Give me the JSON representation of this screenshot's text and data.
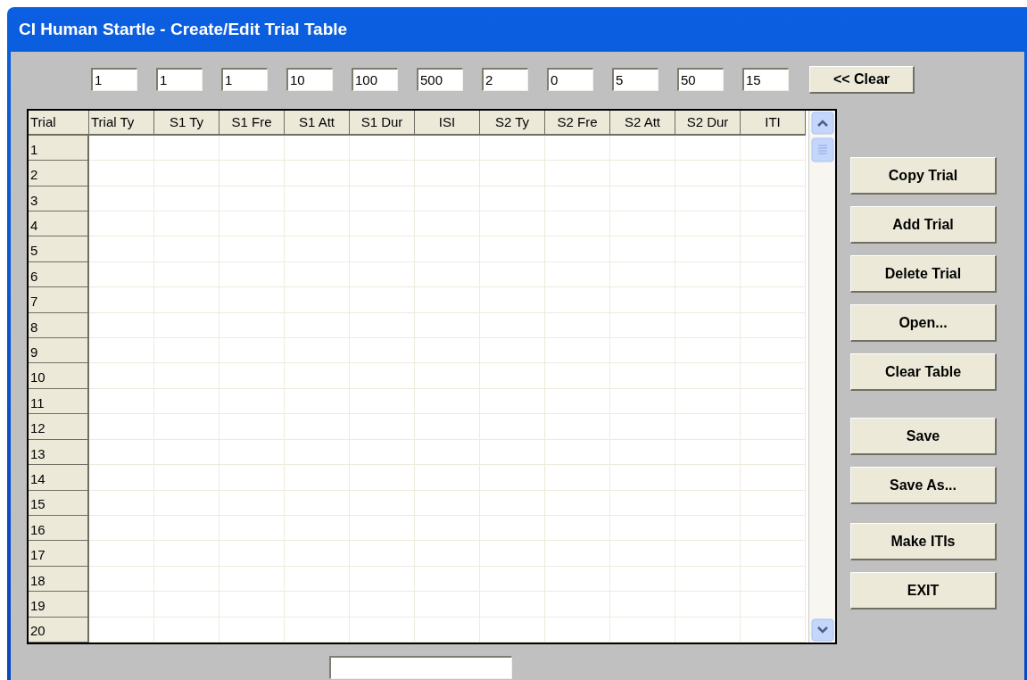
{
  "window": {
    "title": "CI Human Startle - Create/Edit Trial Table"
  },
  "top_fields": [
    "1",
    "1",
    "1",
    "10",
    "100",
    "500",
    "2",
    "0",
    "5",
    "50",
    "15"
  ],
  "clear_button": "<< Clear",
  "table": {
    "columns": [
      "Trial",
      "Trial Ty",
      "S1 Ty",
      "S1 Fre",
      "S1 Att",
      "S1 Dur",
      "ISI",
      "S2 Ty",
      "S2 Fre",
      "S2 Att",
      "S2 Dur",
      "ITI"
    ],
    "rows": [
      "1",
      "2",
      "3",
      "4",
      "5",
      "6",
      "7",
      "8",
      "9",
      "10",
      "11",
      "12",
      "13",
      "14",
      "15",
      "16",
      "17",
      "18",
      "19",
      "20"
    ]
  },
  "buttons": [
    "Copy Trial",
    "Add Trial",
    "Delete Trial",
    "Open...",
    "Clear Table",
    "Save",
    "Save As...",
    "Make ITIs",
    "EXIT"
  ]
}
